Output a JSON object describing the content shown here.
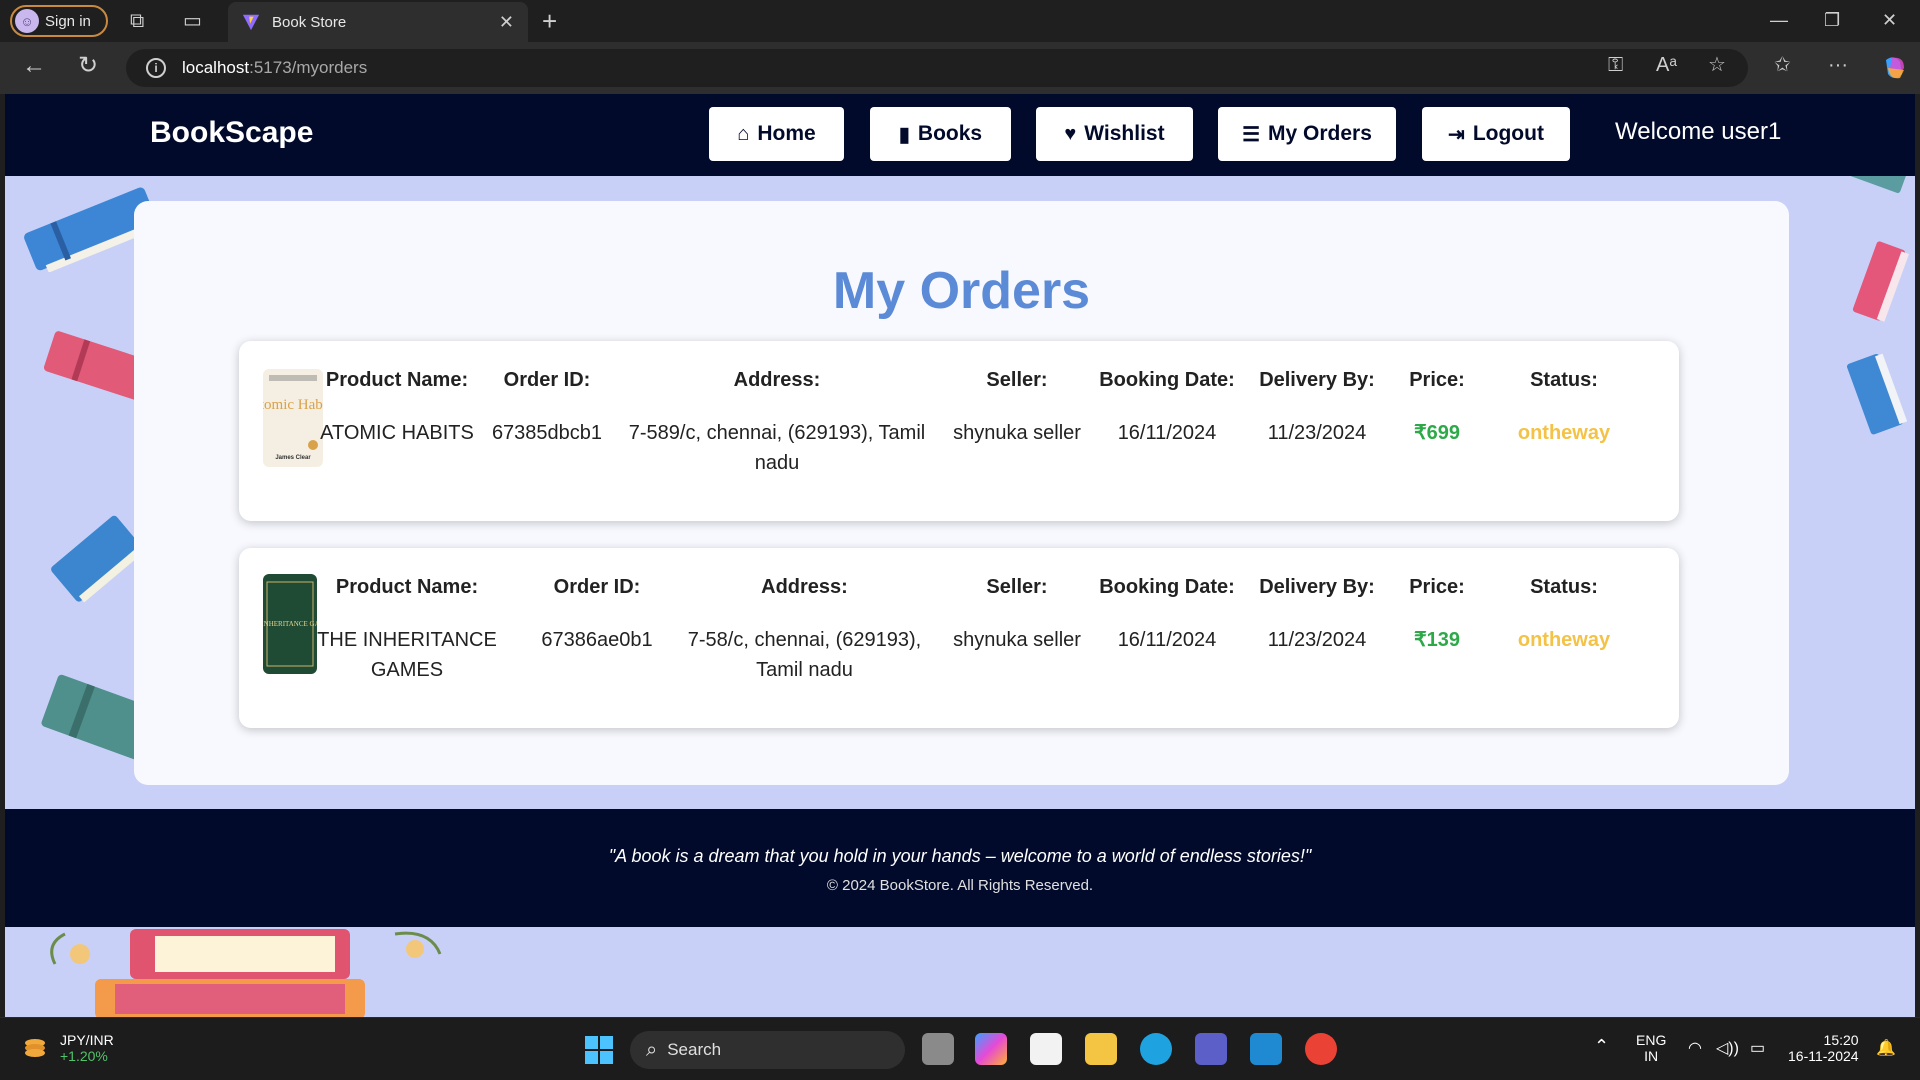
{
  "browser": {
    "profile_label": "Sign in",
    "tab_title": "Book Store",
    "url_host": "localhost",
    "url_path": ":5173/myorders"
  },
  "nav": {
    "brand": "BookScape",
    "buttons": [
      {
        "label": "Home",
        "icon": "home-icon"
      },
      {
        "label": "Books",
        "icon": "book-icon"
      },
      {
        "label": "Wishlist",
        "icon": "heart-icon"
      },
      {
        "label": "My Orders",
        "icon": "list-icon"
      },
      {
        "label": "Logout",
        "icon": "logout-icon"
      }
    ],
    "welcome": "Welcome user1"
  },
  "main": {
    "title": "My Orders",
    "column_labels": {
      "product": "Product Name:",
      "order_id": "Order ID:",
      "address": "Address:",
      "seller": "Seller:",
      "booking": "Booking Date:",
      "delivery": "Delivery By:",
      "price": "Price:",
      "status": "Status:"
    },
    "orders": [
      {
        "product": "ATOMIC HABITS",
        "order_id": "67385dbcb1",
        "address": "7-589/c, chennai, (629193), Tamil nadu",
        "seller": "shynuka seller",
        "booking": "16/11/2024",
        "delivery": "11/23/2024",
        "price": "₹699",
        "status": "ontheway",
        "cover_title": "Atomic Habits",
        "cover_author": "James Clear"
      },
      {
        "product": "THE INHERITANCE GAMES",
        "order_id": "67386ae0b1",
        "address": "7-58/c, chennai, (629193), Tamil nadu",
        "seller": "shynuka seller",
        "booking": "16/11/2024",
        "delivery": "11/23/2024",
        "price": "₹139",
        "status": "ontheway",
        "cover_title": "THE INHERITANCE GAMES"
      }
    ]
  },
  "footer": {
    "quote": "\"A book is a dream that you hold in your hands – welcome to a world of endless stories!\"",
    "copyright": "© 2024 BookStore. All Rights Reserved."
  },
  "taskbar": {
    "ticker_label": "JPY/INR",
    "ticker_change": "+1.20%",
    "search_placeholder": "Search",
    "lang": "ENG",
    "region": "IN",
    "time": "15:20",
    "date": "16-11-2024"
  },
  "colors": {
    "nav_bg": "#020a2b",
    "page_bg": "#c9d0f7",
    "title": "#5b8ad6",
    "price": "#2ea94a",
    "status": "#f4c246"
  }
}
